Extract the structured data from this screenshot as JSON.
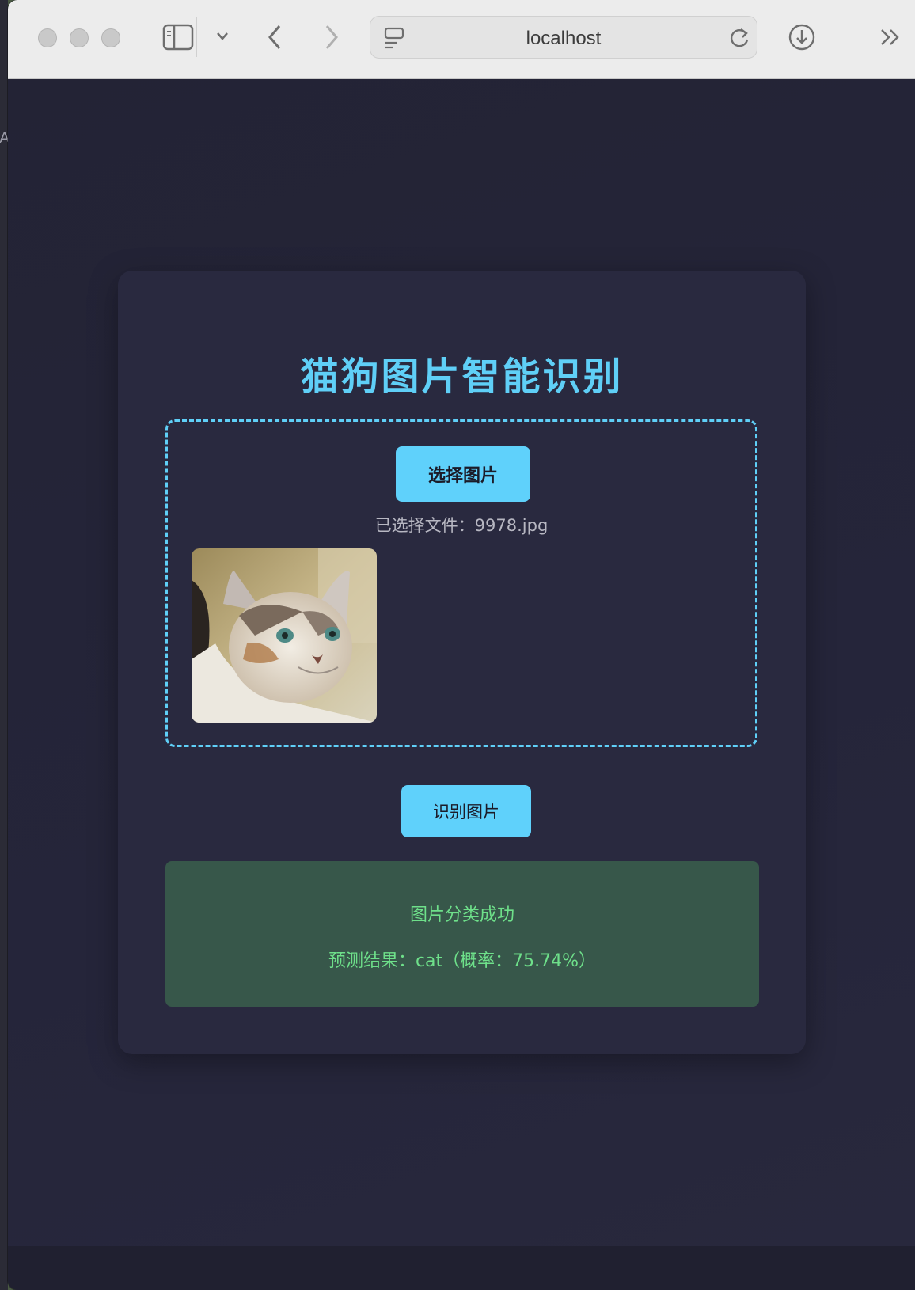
{
  "browser": {
    "address": "localhost"
  },
  "behind_glyph": "A",
  "app": {
    "title": "猫狗图片智能识别",
    "choose_button": "选择图片",
    "selected_file": "已选择文件：9978.jpg",
    "preview_alt": "cat photo preview",
    "identify_button": "识别图片",
    "result": {
      "title": "图片分类成功",
      "text": "预测结果：cat（概率：75.74%）"
    }
  },
  "colors": {
    "accent": "#5fcff7",
    "background": "#252538",
    "card": "#29293f",
    "success_bg": "#37574a",
    "success_text": "#6ee08a"
  }
}
